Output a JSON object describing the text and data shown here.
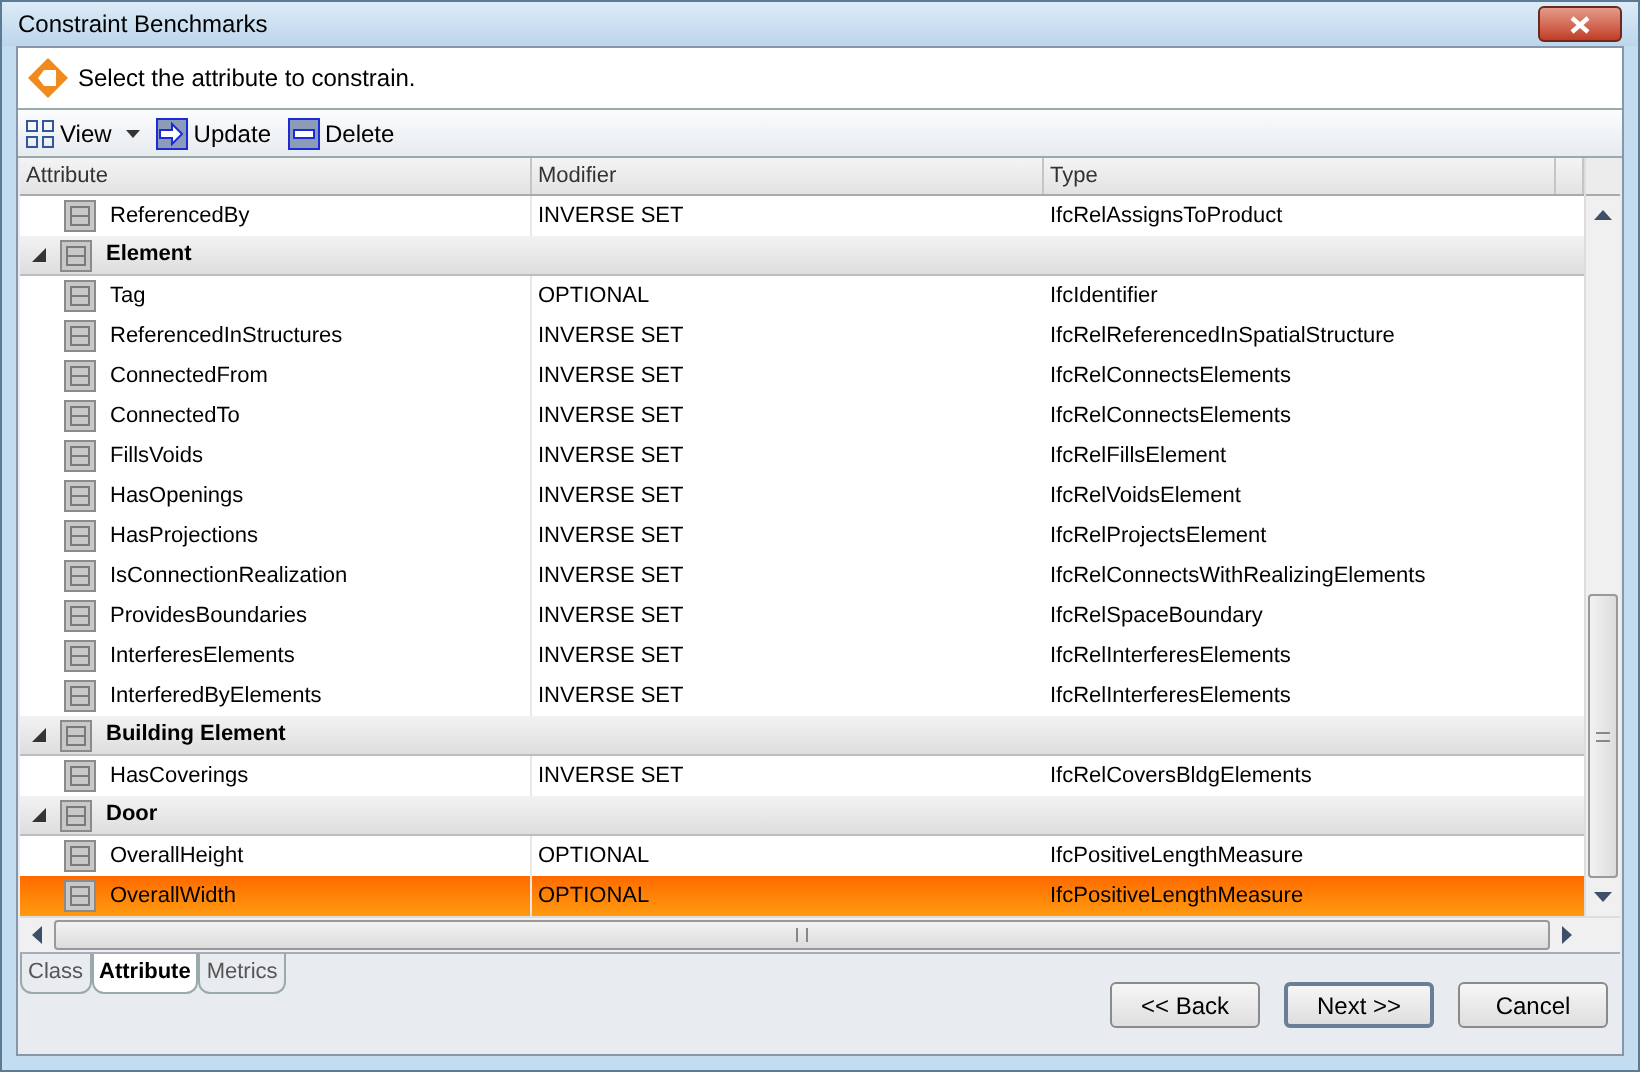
{
  "window": {
    "title": "Constraint Benchmarks"
  },
  "instruction": "Select the attribute to constrain.",
  "toolbar": [
    {
      "label": "View",
      "kind": "view"
    },
    {
      "label": "Update",
      "kind": "update"
    },
    {
      "label": "Delete",
      "kind": "delete"
    }
  ],
  "table": {
    "columns": [
      "Attribute",
      "Modifier",
      "Type"
    ],
    "rows": [
      {
        "kind": "attribute",
        "name": "ReferencedBy",
        "modifier": "INVERSE SET",
        "type": "IfcRelAssignsToProduct",
        "selected": false
      },
      {
        "kind": "group",
        "name": "Element",
        "expanded": true
      },
      {
        "kind": "attribute",
        "name": "Tag",
        "modifier": "OPTIONAL",
        "type": "IfcIdentifier",
        "selected": false
      },
      {
        "kind": "attribute",
        "name": "ReferencedInStructures",
        "modifier": "INVERSE SET",
        "type": "IfcRelReferencedInSpatialStructure",
        "selected": false
      },
      {
        "kind": "attribute",
        "name": "ConnectedFrom",
        "modifier": "INVERSE SET",
        "type": "IfcRelConnectsElements",
        "selected": false
      },
      {
        "kind": "attribute",
        "name": "ConnectedTo",
        "modifier": "INVERSE SET",
        "type": "IfcRelConnectsElements",
        "selected": false
      },
      {
        "kind": "attribute",
        "name": "FillsVoids",
        "modifier": "INVERSE SET",
        "type": "IfcRelFillsElement",
        "selected": false
      },
      {
        "kind": "attribute",
        "name": "HasOpenings",
        "modifier": "INVERSE SET",
        "type": "IfcRelVoidsElement",
        "selected": false
      },
      {
        "kind": "attribute",
        "name": "HasProjections",
        "modifier": "INVERSE SET",
        "type": "IfcRelProjectsElement",
        "selected": false
      },
      {
        "kind": "attribute",
        "name": "IsConnectionRealization",
        "modifier": "INVERSE SET",
        "type": "IfcRelConnectsWithRealizingElements",
        "selected": false
      },
      {
        "kind": "attribute",
        "name": "ProvidesBoundaries",
        "modifier": "INVERSE SET",
        "type": "IfcRelSpaceBoundary",
        "selected": false
      },
      {
        "kind": "attribute",
        "name": "InterferesElements",
        "modifier": "INVERSE SET",
        "type": "IfcRelInterferesElements",
        "selected": false
      },
      {
        "kind": "attribute",
        "name": "InterferedByElements",
        "modifier": "INVERSE SET",
        "type": "IfcRelInterferesElements",
        "selected": false
      },
      {
        "kind": "group",
        "name": "Building Element",
        "expanded": true
      },
      {
        "kind": "attribute",
        "name": "HasCoverings",
        "modifier": "INVERSE SET",
        "type": "IfcRelCoversBldgElements",
        "selected": false
      },
      {
        "kind": "group",
        "name": "Door",
        "expanded": true
      },
      {
        "kind": "attribute",
        "name": "OverallHeight",
        "modifier": "OPTIONAL",
        "type": "IfcPositiveLengthMeasure",
        "selected": false
      },
      {
        "kind": "attribute",
        "name": "OverallWidth",
        "modifier": "OPTIONAL",
        "type": "IfcPositiveLengthMeasure",
        "selected": true
      }
    ]
  },
  "tabs": [
    {
      "label": "Class",
      "selected": false
    },
    {
      "label": "Attribute",
      "selected": true
    },
    {
      "label": "Metrics",
      "selected": false
    }
  ],
  "buttons": [
    {
      "label": "<< Back",
      "default": false
    },
    {
      "label": "Next >>",
      "default": true
    },
    {
      "label": "Cancel",
      "default": false
    }
  ]
}
